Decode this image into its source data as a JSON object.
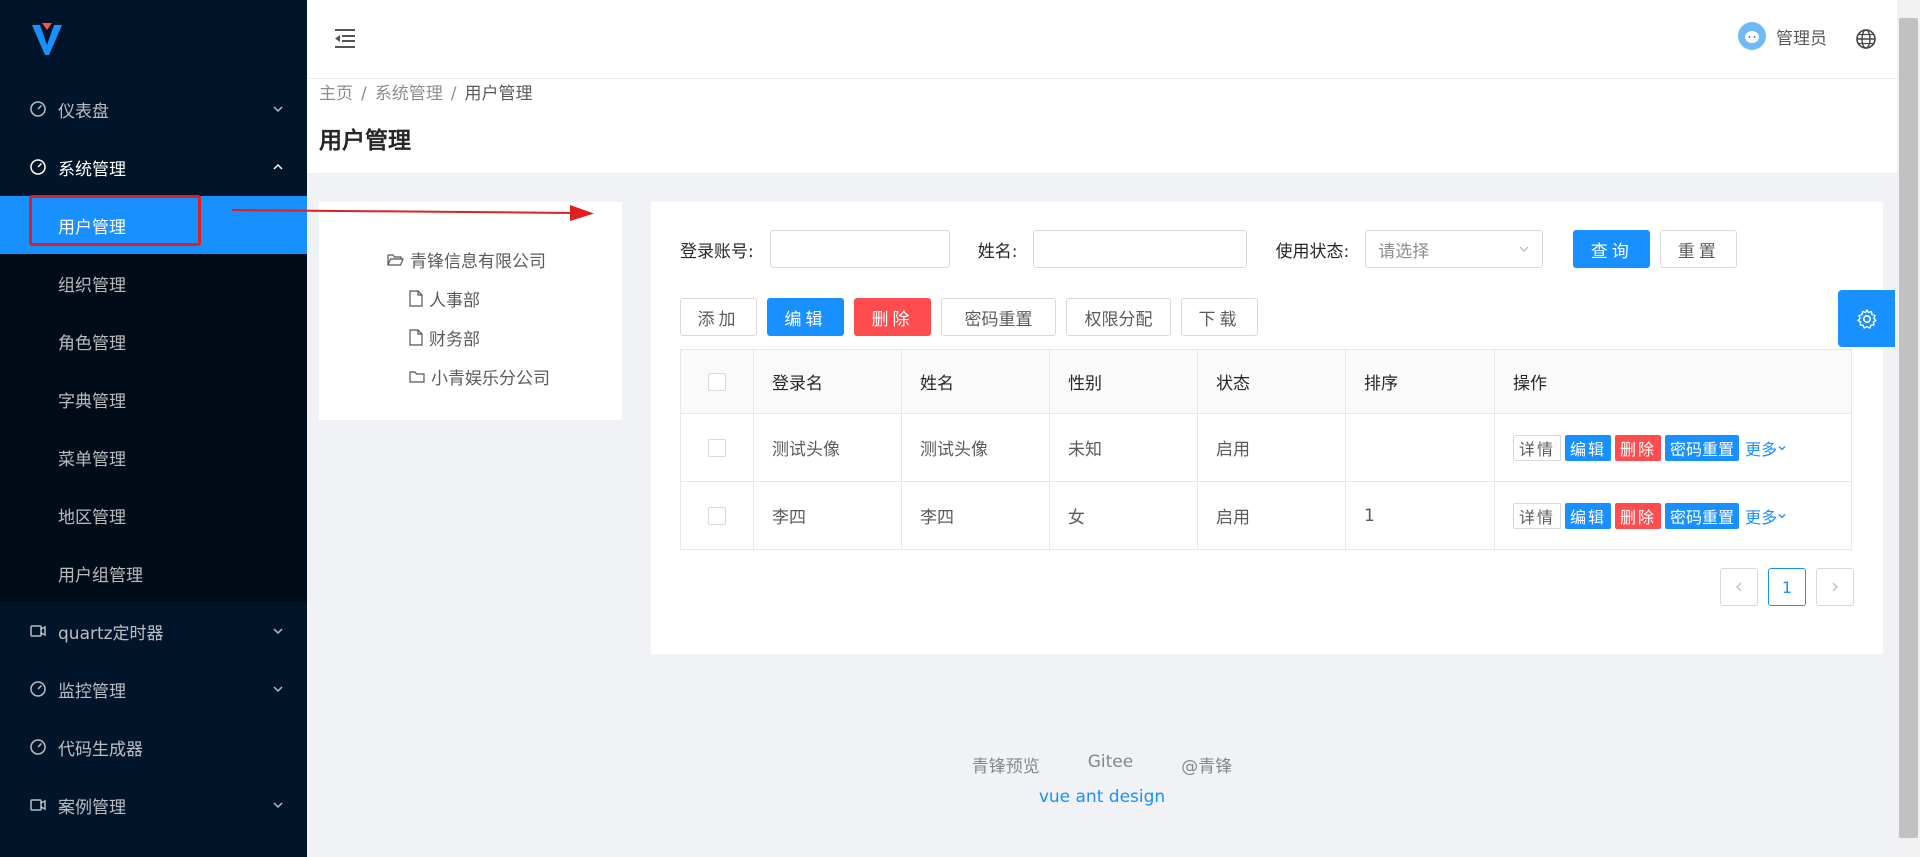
{
  "sidebar": {
    "menu": [
      {
        "label": "仪表盘",
        "icon": "dashboard-icon",
        "expanded": false
      },
      {
        "label": "系统管理",
        "icon": "dashboard-icon",
        "expanded": true
      }
    ],
    "system_sub": [
      {
        "label": "用户管理",
        "active": true
      },
      {
        "label": "组织管理"
      },
      {
        "label": "角色管理"
      },
      {
        "label": "字典管理"
      },
      {
        "label": "菜单管理"
      },
      {
        "label": "地区管理"
      },
      {
        "label": "用户组管理"
      }
    ],
    "menu_after": [
      {
        "label": "quartz定时器",
        "icon": "video-camera-icon",
        "expanded": false
      },
      {
        "label": "监控管理",
        "icon": "dashboard-icon",
        "expanded": false
      },
      {
        "label": "代码生成器",
        "icon": "dashboard-icon"
      },
      {
        "label": "案例管理",
        "icon": "video-camera-icon",
        "expanded": false
      }
    ]
  },
  "header": {
    "username": "管理员"
  },
  "breadcrumb": [
    "主页",
    "系统管理",
    "用户管理"
  ],
  "page_title": "用户管理",
  "tree": {
    "root": "青锋信息有限公司",
    "children": [
      {
        "label": "人事部",
        "icon": "file-icon"
      },
      {
        "label": "财务部",
        "icon": "file-icon"
      },
      {
        "label": "小青娱乐分公司",
        "icon": "folder-icon"
      }
    ]
  },
  "search": {
    "login_label": "登录账号:",
    "login_value": "",
    "name_label": "姓名:",
    "name_value": "",
    "status_label": "使用状态:",
    "status_placeholder": "请选择",
    "query_btn": "查询",
    "reset_btn": "重置"
  },
  "actions": {
    "add": "添加",
    "edit": "编辑",
    "delete": "删除",
    "password_reset": "密码重置",
    "permission": "权限分配",
    "download": "下载"
  },
  "table": {
    "columns": [
      "登录名",
      "姓名",
      "性别",
      "状态",
      "排序",
      "操作"
    ],
    "rows": [
      {
        "login": "测试头像",
        "name": "测试头像",
        "gender": "未知",
        "status": "启用",
        "sort": ""
      },
      {
        "login": "李四",
        "name": "李四",
        "gender": "女",
        "status": "启用",
        "sort": "1"
      }
    ],
    "row_ops": {
      "detail": "详情",
      "edit": "编辑",
      "delete": "删除",
      "reset": "密码重置",
      "more": "更多"
    }
  },
  "pagination": {
    "current": "1"
  },
  "footer": {
    "links": [
      "青锋预览",
      "Gitee",
      "@青锋"
    ],
    "sub": "vue ant design"
  },
  "colors": {
    "primary": "#1890ff",
    "danger": "#ff4d4f",
    "sider": "#001529",
    "annotation": "#e02020"
  }
}
